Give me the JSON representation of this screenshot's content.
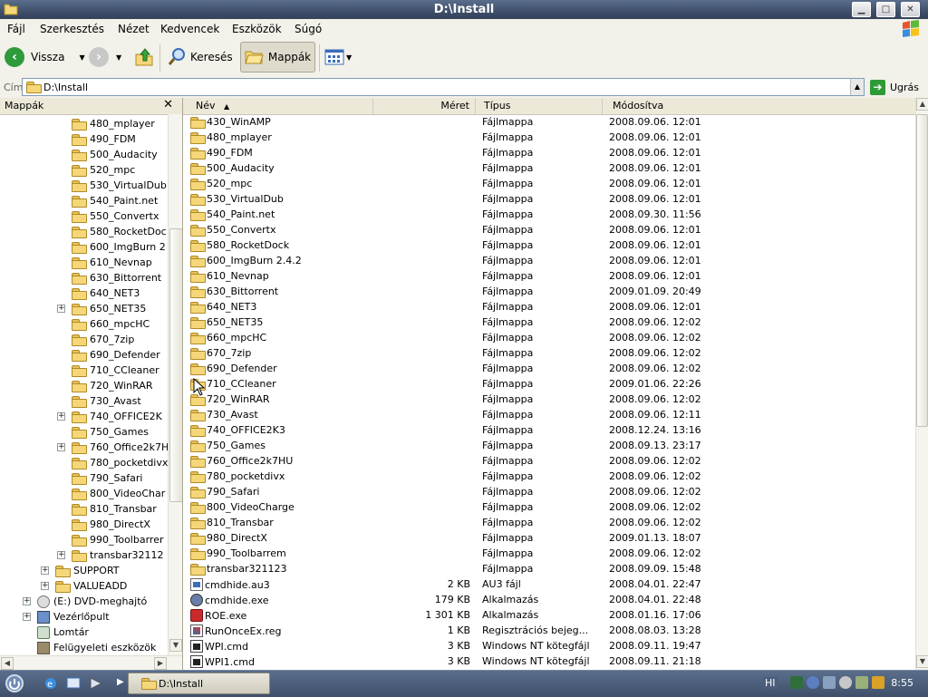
{
  "window": {
    "title": "D:\\Install"
  },
  "menu": [
    "Fájl",
    "Szerkesztés",
    "Nézet",
    "Kedvencek",
    "Eszközök",
    "Súgó"
  ],
  "toolbar": {
    "back": "Vissza",
    "search": "Keresés",
    "folders": "Mappák"
  },
  "address": {
    "label": "Cím",
    "value": "D:\\Install",
    "go": "Ugrás"
  },
  "tree": {
    "title": "Mappák",
    "items": [
      {
        "label": "480_mplayer"
      },
      {
        "label": "490_FDM"
      },
      {
        "label": "500_Audacity"
      },
      {
        "label": "520_mpc"
      },
      {
        "label": "530_VirtualDub"
      },
      {
        "label": "540_Paint.net"
      },
      {
        "label": "550_Convertx"
      },
      {
        "label": "580_RocketDoc"
      },
      {
        "label": "600_ImgBurn 2"
      },
      {
        "label": "610_Nevnap"
      },
      {
        "label": "630_Bittorrent"
      },
      {
        "label": "640_NET3"
      },
      {
        "label": "650_NET35"
      },
      {
        "label": "660_mpcHC"
      },
      {
        "label": "670_7zip"
      },
      {
        "label": "690_Defender"
      },
      {
        "label": "710_CCleaner"
      },
      {
        "label": "720_WinRAR"
      },
      {
        "label": "730_Avast"
      },
      {
        "label": "740_OFFICE2K"
      },
      {
        "label": "750_Games"
      },
      {
        "label": "760_Office2k7H"
      },
      {
        "label": "780_pocketdivx"
      },
      {
        "label": "790_Safari"
      },
      {
        "label": "800_VideoChar"
      },
      {
        "label": "810_Transbar"
      },
      {
        "label": "980_DirectX"
      },
      {
        "label": "990_Toolbarrer"
      },
      {
        "label": "transbar32112"
      },
      {
        "label": "SUPPORT"
      },
      {
        "label": "VALUEADD"
      },
      {
        "label": "(E:) DVD-meghajtó"
      },
      {
        "label": "Vezérlőpult"
      },
      {
        "label": "Lomtár"
      },
      {
        "label": "Felügyeleti eszközök"
      }
    ]
  },
  "columns": {
    "name": "Név",
    "size": "Méret",
    "type": "Típus",
    "modified": "Módosítva"
  },
  "files": [
    {
      "name": "430_WinAMP",
      "size": "",
      "type": "Fájlmappa",
      "modified": "2008.09.06. 12:01",
      "icon": "folder"
    },
    {
      "name": "480_mplayer",
      "size": "",
      "type": "Fájlmappa",
      "modified": "2008.09.06. 12:01",
      "icon": "folder"
    },
    {
      "name": "490_FDM",
      "size": "",
      "type": "Fájlmappa",
      "modified": "2008.09.06. 12:01",
      "icon": "folder"
    },
    {
      "name": "500_Audacity",
      "size": "",
      "type": "Fájlmappa",
      "modified": "2008.09.06. 12:01",
      "icon": "folder"
    },
    {
      "name": "520_mpc",
      "size": "",
      "type": "Fájlmappa",
      "modified": "2008.09.06. 12:01",
      "icon": "folder"
    },
    {
      "name": "530_VirtualDub",
      "size": "",
      "type": "Fájlmappa",
      "modified": "2008.09.06. 12:01",
      "icon": "folder"
    },
    {
      "name": "540_Paint.net",
      "size": "",
      "type": "Fájlmappa",
      "modified": "2008.09.30. 11:56",
      "icon": "folder"
    },
    {
      "name": "550_Convertx",
      "size": "",
      "type": "Fájlmappa",
      "modified": "2008.09.06. 12:01",
      "icon": "folder"
    },
    {
      "name": "580_RocketDock",
      "size": "",
      "type": "Fájlmappa",
      "modified": "2008.09.06. 12:01",
      "icon": "folder"
    },
    {
      "name": "600_ImgBurn 2.4.2",
      "size": "",
      "type": "Fájlmappa",
      "modified": "2008.09.06. 12:01",
      "icon": "folder"
    },
    {
      "name": "610_Nevnap",
      "size": "",
      "type": "Fájlmappa",
      "modified": "2008.09.06. 12:01",
      "icon": "folder"
    },
    {
      "name": "630_Bittorrent",
      "size": "",
      "type": "Fájlmappa",
      "modified": "2009.01.09. 20:49",
      "icon": "folder"
    },
    {
      "name": "640_NET3",
      "size": "",
      "type": "Fájlmappa",
      "modified": "2008.09.06. 12:01",
      "icon": "folder"
    },
    {
      "name": "650_NET35",
      "size": "",
      "type": "Fájlmappa",
      "modified": "2008.09.06. 12:02",
      "icon": "folder"
    },
    {
      "name": "660_mpcHC",
      "size": "",
      "type": "Fájlmappa",
      "modified": "2008.09.06. 12:02",
      "icon": "folder"
    },
    {
      "name": "670_7zip",
      "size": "",
      "type": "Fájlmappa",
      "modified": "2008.09.06. 12:02",
      "icon": "folder"
    },
    {
      "name": "690_Defender",
      "size": "",
      "type": "Fájlmappa",
      "modified": "2008.09.06. 12:02",
      "icon": "folder"
    },
    {
      "name": "710_CCleaner",
      "size": "",
      "type": "Fájlmappa",
      "modified": "2009.01.06. 22:26",
      "icon": "folder"
    },
    {
      "name": "720_WinRAR",
      "size": "",
      "type": "Fájlmappa",
      "modified": "2008.09.06. 12:02",
      "icon": "folder"
    },
    {
      "name": "730_Avast",
      "size": "",
      "type": "Fájlmappa",
      "modified": "2008.09.06. 12:11",
      "icon": "folder"
    },
    {
      "name": "740_OFFICE2K3",
      "size": "",
      "type": "Fájlmappa",
      "modified": "2008.12.24. 13:16",
      "icon": "folder"
    },
    {
      "name": "750_Games",
      "size": "",
      "type": "Fájlmappa",
      "modified": "2008.09.13. 23:17",
      "icon": "folder"
    },
    {
      "name": "760_Office2k7HU",
      "size": "",
      "type": "Fájlmappa",
      "modified": "2008.09.06. 12:02",
      "icon": "folder"
    },
    {
      "name": "780_pocketdivx",
      "size": "",
      "type": "Fájlmappa",
      "modified": "2008.09.06. 12:02",
      "icon": "folder"
    },
    {
      "name": "790_Safari",
      "size": "",
      "type": "Fájlmappa",
      "modified": "2008.09.06. 12:02",
      "icon": "folder"
    },
    {
      "name": "800_VideoCharge",
      "size": "",
      "type": "Fájlmappa",
      "modified": "2008.09.06. 12:02",
      "icon": "folder"
    },
    {
      "name": "810_Transbar",
      "size": "",
      "type": "Fájlmappa",
      "modified": "2008.09.06. 12:02",
      "icon": "folder"
    },
    {
      "name": "980_DirectX",
      "size": "",
      "type": "Fájlmappa",
      "modified": "2009.01.13. 18:07",
      "icon": "folder"
    },
    {
      "name": "990_Toolbarrem",
      "size": "",
      "type": "Fájlmappa",
      "modified": "2008.09.06. 12:02",
      "icon": "folder"
    },
    {
      "name": "transbar321123",
      "size": "",
      "type": "Fájlmappa",
      "modified": "2008.09.09. 15:48",
      "icon": "folder"
    },
    {
      "name": "cmdhide.au3",
      "size": "2 KB",
      "type": "AU3 fájl",
      "modified": "2008.04.01. 22:47",
      "icon": "au3"
    },
    {
      "name": "cmdhide.exe",
      "size": "179 KB",
      "type": "Alkalmazás",
      "modified": "2008.04.01. 22:48",
      "icon": "exe"
    },
    {
      "name": "ROE.exe",
      "size": "1 301 KB",
      "type": "Alkalmazás",
      "modified": "2008.01.16. 17:06",
      "icon": "roe"
    },
    {
      "name": "RunOnceEx.reg",
      "size": "1 KB",
      "type": "Regisztrációs bejeg...",
      "modified": "2008.08.03. 13:28",
      "icon": "reg"
    },
    {
      "name": "WPI.cmd",
      "size": "3 KB",
      "type": "Windows NT kötegfájl",
      "modified": "2008.09.11. 19:47",
      "icon": "cmd"
    },
    {
      "name": "WPI1.cmd",
      "size": "3 KB",
      "type": "Windows NT kötegfájl",
      "modified": "2008.09.11. 21:18",
      "icon": "cmd"
    }
  ],
  "taskbar": {
    "active_window": "D:\\Install",
    "tray_lang": "HI",
    "clock": "8:55"
  }
}
